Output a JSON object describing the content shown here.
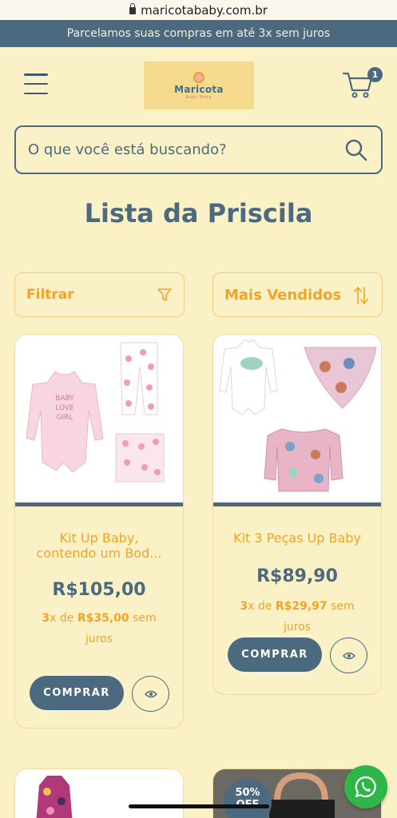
{
  "browser": {
    "url": "maricotababy.com.br"
  },
  "promo_banner": "Parcelamos suas compras em até 3x sem juros",
  "header": {
    "logo_name": "Maricota",
    "logo_sub": "Baby Store",
    "cart_count": "1"
  },
  "search": {
    "placeholder": "O que você está buscando?"
  },
  "page_title": "Lista da Priscila",
  "toolbar": {
    "filter_label": "Filtrar",
    "sort_label": "Mais Vendidos"
  },
  "products": [
    {
      "name": "Kit Up Baby, contendo um Bod...",
      "price": "R$105,00",
      "installments_count": "3",
      "installments_mid": "x de ",
      "installment_value": "R$35,00",
      "installments_suffix": " sem juros",
      "buy_label": "COMPRAR"
    },
    {
      "name": "Kit 3 Peças Up Baby",
      "price": "R$89,90",
      "installments_count": "3",
      "installments_mid": "x de ",
      "installment_value": "R$29,97",
      "installments_suffix": " sem juros",
      "buy_label": "COMPRAR"
    }
  ],
  "discount_badge": {
    "line1": "50%",
    "line2": "OFF"
  },
  "colors": {
    "primary": "#4b6a80",
    "accent": "#efa42a",
    "background": "#faf1c6",
    "whatsapp": "#2fb64a"
  },
  "icons": [
    "menu-icon",
    "cart-icon",
    "search-icon",
    "filter-icon",
    "sort-icon",
    "eye-icon",
    "whatsapp-icon",
    "lock-icon"
  ]
}
